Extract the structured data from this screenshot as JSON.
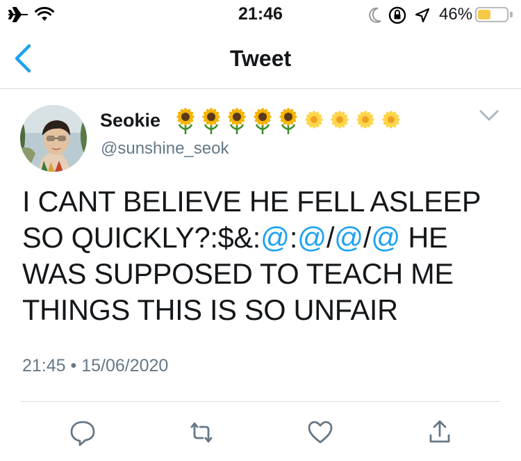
{
  "status_bar": {
    "time": "21:46",
    "battery_percent": "46%",
    "battery_level": 0.46,
    "icons": [
      "airplane-icon",
      "wifi-icon",
      "moon-icon",
      "rotation-lock-icon",
      "location-arrow-icon",
      "battery-icon"
    ]
  },
  "nav": {
    "title": "Tweet",
    "back_icon": "chevron-left-icon"
  },
  "tweet": {
    "display_name": "Seokie",
    "name_emojis": [
      "🌻",
      "🌻",
      "🌻",
      "🌻",
      "🌻",
      "🌼",
      "🌼",
      "🌼",
      "🌼"
    ],
    "handle": "@sunshine_seok",
    "text_parts": {
      "p1": "I CANT BELIEVE HE FELL ASLEEP SO QUICKLY?:$&:",
      "m1": "@",
      "s1": ":",
      "m2": "@",
      "s2": "/",
      "m3": "@",
      "s3": "/",
      "m4": "@",
      "p2": " HE WAS SUPPOSED TO TEACH ME THINGS THIS IS SO UNFAIR"
    },
    "timestamp": "21:45 • 15/06/2020"
  },
  "actions": [
    "reply-icon",
    "retweet-icon",
    "like-icon",
    "share-icon"
  ],
  "colors": {
    "accent": "#1da1f2",
    "nav_back": "#1da1f2",
    "secondary_text": "#657786",
    "divider": "#d8dde0",
    "battery": "#f7c948"
  }
}
